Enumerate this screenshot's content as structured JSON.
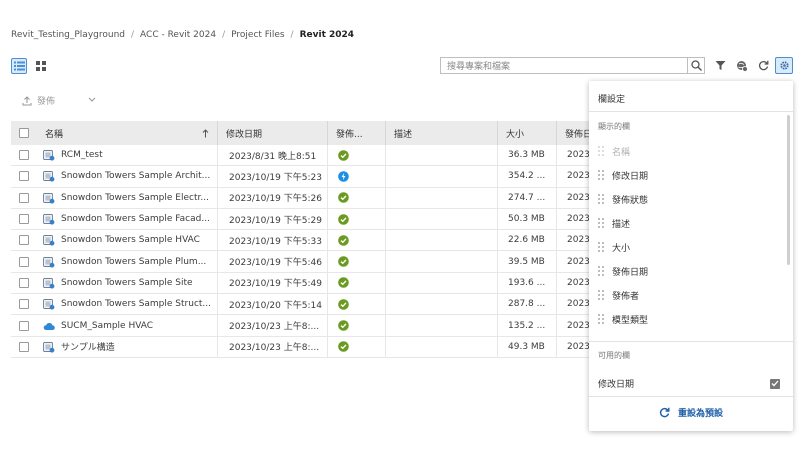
{
  "breadcrumb": {
    "items": [
      "Revit_Testing_Playground",
      "ACC - Revit 2024",
      "Project Files"
    ],
    "current": "Revit 2024",
    "separator": "/"
  },
  "toolbar": {
    "list_view_icon": "list-view-icon",
    "grid_view_icon": "grid-view-icon",
    "search_placeholder": "搜尋專案和檔案",
    "publish_label": "發佈"
  },
  "table": {
    "headers": {
      "name": "名稱",
      "modified": "修改日期",
      "status": "發佈...",
      "description": "描述",
      "size": "大小",
      "published": "發佈日"
    },
    "rows": [
      {
        "icon": "revit-file-icon",
        "name": "RCM_test",
        "modified": "2023/8/31 晚上8:51",
        "status": "success",
        "size": "36.3 MB",
        "published": "2023"
      },
      {
        "icon": "revit-file-icon",
        "name": "Snowdon Towers Sample Archit...",
        "modified": "2023/10/19 下午5:23",
        "status": "processing",
        "size": "354.2 ...",
        "published": "2023"
      },
      {
        "icon": "revit-file-icon",
        "name": "Snowdon Towers Sample Electr...",
        "modified": "2023/10/19 下午5:26",
        "status": "success",
        "size": "274.7 ...",
        "published": "2023"
      },
      {
        "icon": "revit-file-icon",
        "name": "Snowdon Towers Sample Facad...",
        "modified": "2023/10/19 下午5:29",
        "status": "success",
        "size": "50.3 MB",
        "published": "2023"
      },
      {
        "icon": "revit-file-icon",
        "name": "Snowdon Towers Sample HVAC",
        "modified": "2023/10/19 下午5:33",
        "status": "success",
        "size": "22.6 MB",
        "published": "2023"
      },
      {
        "icon": "revit-file-icon",
        "name": "Snowdon Towers Sample Plum...",
        "modified": "2023/10/19 下午5:46",
        "status": "success",
        "size": "39.5 MB",
        "published": "2023"
      },
      {
        "icon": "revit-file-icon",
        "name": "Snowdon Towers Sample Site",
        "modified": "2023/10/19 下午5:49",
        "status": "success",
        "size": "193.6 ...",
        "published": "2023"
      },
      {
        "icon": "revit-file-icon",
        "name": "Snowdon Towers Sample Struct...",
        "modified": "2023/10/20 下午5:14",
        "status": "success",
        "size": "287.8 ...",
        "published": "2023"
      },
      {
        "icon": "cloud-model-icon",
        "name": "SUCM_Sample HVAC",
        "modified": "2023/10/23 上午8:...",
        "status": "success",
        "size": "135.2 ...",
        "published": "2023"
      },
      {
        "icon": "revit-file-icon",
        "name": "サンプル構造",
        "modified": "2023/10/23 上午8:...",
        "status": "success",
        "size": "49.3 MB",
        "published": "2023"
      }
    ]
  },
  "panel": {
    "title": "欄設定",
    "displayed_section": "顯示的欄",
    "displayed_columns": [
      {
        "label": "名稱",
        "disabled": true
      },
      {
        "label": "修改日期",
        "disabled": false
      },
      {
        "label": "發佈狀態",
        "disabled": false
      },
      {
        "label": "描述",
        "disabled": false
      },
      {
        "label": "大小",
        "disabled": false
      },
      {
        "label": "發佈日期",
        "disabled": false
      },
      {
        "label": "發佈者",
        "disabled": false
      },
      {
        "label": "模型類型",
        "disabled": false
      }
    ],
    "available_section": "可用的欄",
    "available_columns": [
      {
        "label": "修改日期",
        "checked": true
      }
    ],
    "reset_label": "重設為預設"
  },
  "colors": {
    "accent": "#4a90d9",
    "success": "#6a9a1f",
    "processing": "#1a8fe3",
    "link": "#1f5fa8"
  }
}
